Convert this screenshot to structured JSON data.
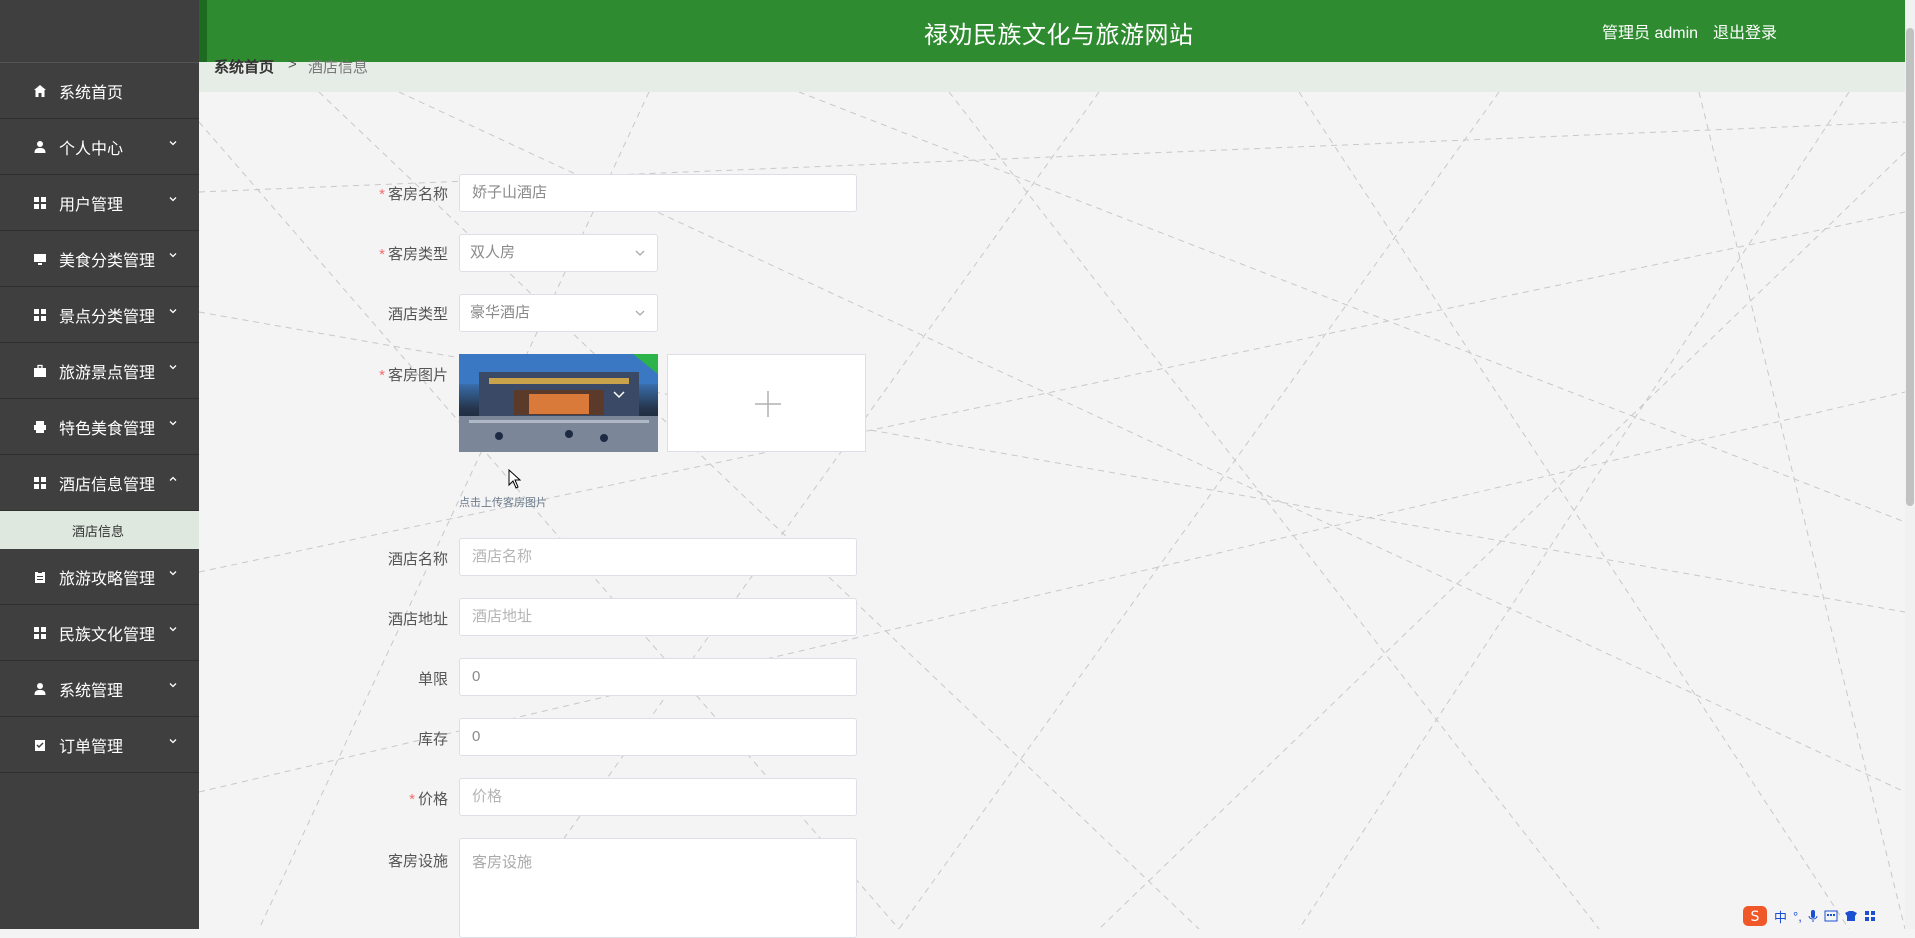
{
  "header": {
    "title": "禄劝民族文化与旅游网站",
    "admin_label": "管理员 admin",
    "logout": "退出登录"
  },
  "breadcrumb": {
    "home": "系统首页",
    "separator": ">",
    "current": "酒店信息"
  },
  "sidebar": {
    "items": [
      {
        "label": "系统首页",
        "icon": "home-icon",
        "expandable": false
      },
      {
        "label": "个人中心",
        "icon": "user-icon",
        "expandable": true
      },
      {
        "label": "用户管理",
        "icon": "grid-icon",
        "expandable": true
      },
      {
        "label": "美食分类管理",
        "icon": "monitor-icon",
        "expandable": true
      },
      {
        "label": "景点分类管理",
        "icon": "grid-icon",
        "expandable": true
      },
      {
        "label": "旅游景点管理",
        "icon": "briefcase-icon",
        "expandable": true
      },
      {
        "label": "特色美食管理",
        "icon": "print-icon",
        "expandable": true
      },
      {
        "label": "酒店信息管理",
        "icon": "grid-icon",
        "expandable": true,
        "expanded": true
      },
      {
        "label": "旅游攻略管理",
        "icon": "clipboard-icon",
        "expandable": true
      },
      {
        "label": "民族文化管理",
        "icon": "grid-icon",
        "expandable": true
      },
      {
        "label": "系统管理",
        "icon": "person-icon",
        "expandable": true
      },
      {
        "label": "订单管理",
        "icon": "checklist-icon",
        "expandable": true
      }
    ],
    "submenu": {
      "label": "酒店信息"
    }
  },
  "form": {
    "room_name": {
      "label": "客房名称",
      "required": true,
      "value": "娇子山酒店"
    },
    "room_type": {
      "label": "客房类型",
      "required": true,
      "value": "双人房"
    },
    "hotel_type": {
      "label": "酒店类型",
      "required": false,
      "value": "豪华酒店"
    },
    "room_image": {
      "label": "客房图片",
      "required": true,
      "hint": "点击上传客房图片"
    },
    "hotel_name": {
      "label": "酒店名称",
      "required": false,
      "placeholder": "酒店名称"
    },
    "hotel_address": {
      "label": "酒店地址",
      "required": false,
      "placeholder": "酒店地址"
    },
    "limit": {
      "label": "单限",
      "required": false,
      "value": "0"
    },
    "stock": {
      "label": "库存",
      "required": false,
      "value": "0"
    },
    "price": {
      "label": "价格",
      "required": true,
      "placeholder": "价格"
    },
    "facilities": {
      "label": "客房设施",
      "required": false,
      "placeholder": "客房设施"
    }
  },
  "ime": {
    "label": "中"
  },
  "colors": {
    "header": "#2e8b30",
    "sidebar": "#3f3f3f",
    "required": "#f56c6c"
  }
}
